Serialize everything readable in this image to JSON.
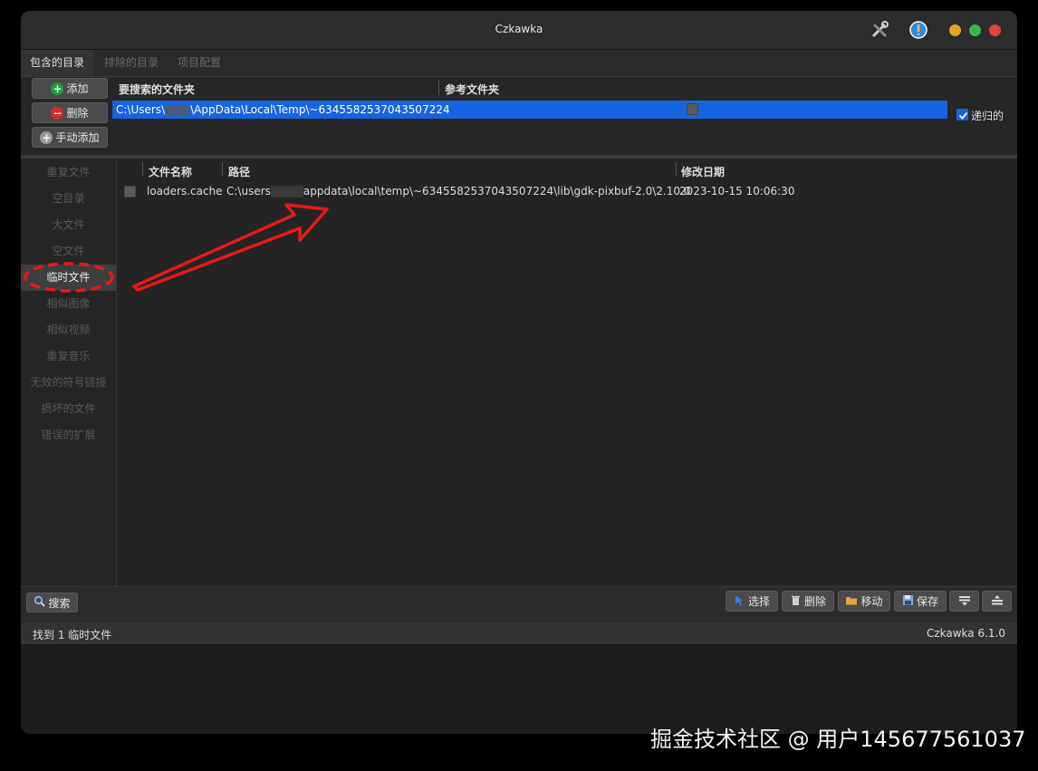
{
  "window": {
    "title": "Czkawka"
  },
  "tabs": [
    {
      "label": "包含的目录",
      "active": true
    },
    {
      "label": "排除的目录",
      "active": false
    },
    {
      "label": "项目配置",
      "active": false
    }
  ],
  "directories": {
    "add_button": "添加",
    "remove_button": "删除",
    "manual_add_button": "手动添加",
    "header_search": "要搜索的文件夹",
    "header_reference": "参考文件夹",
    "rows": [
      {
        "path_prefix": "C:\\Users\\",
        "path_suffix": "\\AppData\\Local\\Temp\\~6345582537043507224",
        "reference": false
      }
    ],
    "recursive_label": "递归的",
    "recursive_checked": true
  },
  "sidebar": {
    "items": [
      {
        "label": "重复文件",
        "active": false
      },
      {
        "label": "空目录",
        "active": false
      },
      {
        "label": "大文件",
        "active": false
      },
      {
        "label": "空文件",
        "active": false
      },
      {
        "label": "临时文件",
        "active": true
      },
      {
        "label": "相似图像",
        "active": false
      },
      {
        "label": "相似视频",
        "active": false
      },
      {
        "label": "重复音乐",
        "active": false
      },
      {
        "label": "无效的符号链接",
        "active": false
      },
      {
        "label": "损坏的文件",
        "active": false
      },
      {
        "label": "错误的扩展",
        "active": false
      }
    ]
  },
  "results": {
    "columns": {
      "name": "文件名称",
      "path": "路径",
      "modified": "修改日期"
    },
    "rows": [
      {
        "checked": false,
        "name": "loaders.cache",
        "path_prefix": "C:\\users",
        "path_suffix": "appdata\\local\\temp\\~6345582537043507224\\lib\\gdk-pixbuf-2.0\\2.10.0",
        "modified": "2023-10-15 10:06:30"
      }
    ]
  },
  "toolbar": {
    "search": "搜索",
    "select": "选择",
    "delete": "删除",
    "move": "移动",
    "save": "保存"
  },
  "status": {
    "message": "找到 1 临时文件",
    "version": "Czkawka 6.1.0"
  },
  "watermark": "掘金技术社区 @ 用户145677561037",
  "colors": {
    "selection": "#1565e0",
    "annotation": "#e51a1a",
    "add_icon": "#1e9e3a",
    "remove_icon": "#d42b2b",
    "traffic_yellow": "#e2a521",
    "traffic_green": "#3cb54a",
    "traffic_red": "#e0443e"
  },
  "icons": [
    "tools-icon",
    "info-icon",
    "plus-icon",
    "minus-icon",
    "search-icon",
    "select-icon",
    "trash-icon",
    "folder-icon",
    "save-icon",
    "sort-icon",
    "hide-icon"
  ]
}
